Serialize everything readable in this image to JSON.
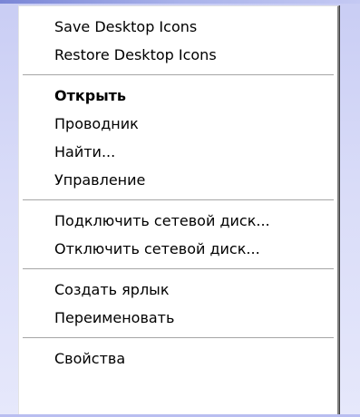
{
  "menu": {
    "groups": [
      {
        "items": [
          {
            "label": "Save Desktop Icons"
          },
          {
            "label": "Restore Desktop Icons"
          }
        ]
      },
      {
        "items": [
          {
            "label": "Открыть"
          },
          {
            "label": "Проводник"
          },
          {
            "label": "Найти..."
          },
          {
            "label": "Управление"
          }
        ]
      },
      {
        "items": [
          {
            "label": "Подключить сетевой диск..."
          },
          {
            "label": "Отключить сетевой диск..."
          }
        ]
      },
      {
        "items": [
          {
            "label": "Создать ярлык"
          },
          {
            "label": "Переименовать"
          }
        ]
      },
      {
        "items": [
          {
            "label": "Свойства"
          }
        ]
      }
    ]
  }
}
